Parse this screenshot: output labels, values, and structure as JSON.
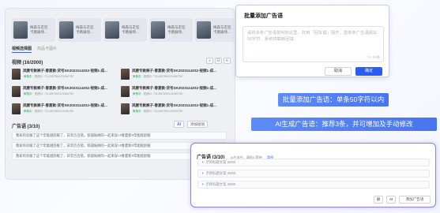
{
  "thumbnails": [
    {
      "line1": "梅森与走狂",
      "line2": "卡路展场..."
    },
    {
      "line1": "梅森与走狂",
      "line2": "卡路展场..."
    },
    {
      "line1": "梅森与走狂",
      "line2": "卡路展场..."
    },
    {
      "line1": "梅森与走狂",
      "line2": "卡路展场..."
    },
    {
      "line1": "梅森与走狂",
      "line2": "卡路展场..."
    }
  ],
  "tabs": {
    "active": "视频选择图",
    "inactive": "商品卡图片"
  },
  "video_section": {
    "title": "视频 (16/2000)",
    "cards": [
      {
        "name": "岚腰专款裤子-春夏款-货号SK20231143S2-视频1-成...",
        "badge": "审核中",
        "meta": "视频ID: 7314567890123456789"
      },
      {
        "name": "岚腰专款裤子-春夏款-货号SK20231143S2-视频1-成...",
        "badge": "审核中",
        "meta": "视频ID: 7314567890123456789"
      },
      {
        "name": "岚腰专款裤子-春夏款-货号SK20231143S2-视频1-成...",
        "badge": "审核中",
        "meta": "视频ID: 7314567890123456789"
      },
      {
        "name": "岚腰专款裤子-春夏款-货号SK20231143S2-视频1-成...",
        "badge": "审核中",
        "meta": "视频ID: 7314567890123456789"
      },
      {
        "name": "岚腰专款裤子-春夏款-货号SK20231143S2-视频1-成...",
        "badge": "审核中",
        "meta": "视频ID: 7314567890123456789"
      },
      {
        "name": "岚腰专款裤子-春夏款-货号SK20231143S2-视频1-成...",
        "badge": "审核中",
        "meta": "视频ID: 7314567890123456789"
      }
    ]
  },
  "bg_ad_section": {
    "title": "广告语 (3/10)",
    "ai_button": "AI",
    "add_button": "添加短语",
    "lines": [
      "我家的衣服了这个牢能越舒服了，日常百百搭，铁铺陆顾的一起来穿! #春夏新#牢能越舒服",
      "我家的衣服了这个牢能越舒服了，日常百百搭，铁铺陆顾的一起来穿! #春夏新#牢能越舒服",
      "我家的衣服了这个牢能越舒服了，日常百百搭，铁铺陆顾的一起来穿! #春夏新#牢能越舒服"
    ]
  },
  "dialog": {
    "title": "批量添加广告语",
    "placeholder": "请将多条广告语复制到这里，并用「回车键」隔开，若单条广告语超出50字符，系统将截断回填",
    "counter": "0 / 10条",
    "cancel_label": "取消",
    "ok_label": "确定"
  },
  "callouts": {
    "batch": "批量添加广告语：单条50字符以内",
    "ai": "AI生成广告语：推荐3条，并可增加及手动修改"
  },
  "zoom_panel": {
    "title": "广告语 (3/10)",
    "hint": "AI生成中，请耐心等待",
    "link": "暂停",
    "lines": [
      "示例标题文案 20/50",
      "示例标题文案 20/50",
      "示例标题文案 20/50"
    ],
    "delete_label": "删",
    "ai_label": "AI",
    "add_label": "添加广告语"
  },
  "colors": {
    "accent": "#2b5cf6",
    "callout": "#4a74ef",
    "zoom_border": "#8f7ef5"
  }
}
